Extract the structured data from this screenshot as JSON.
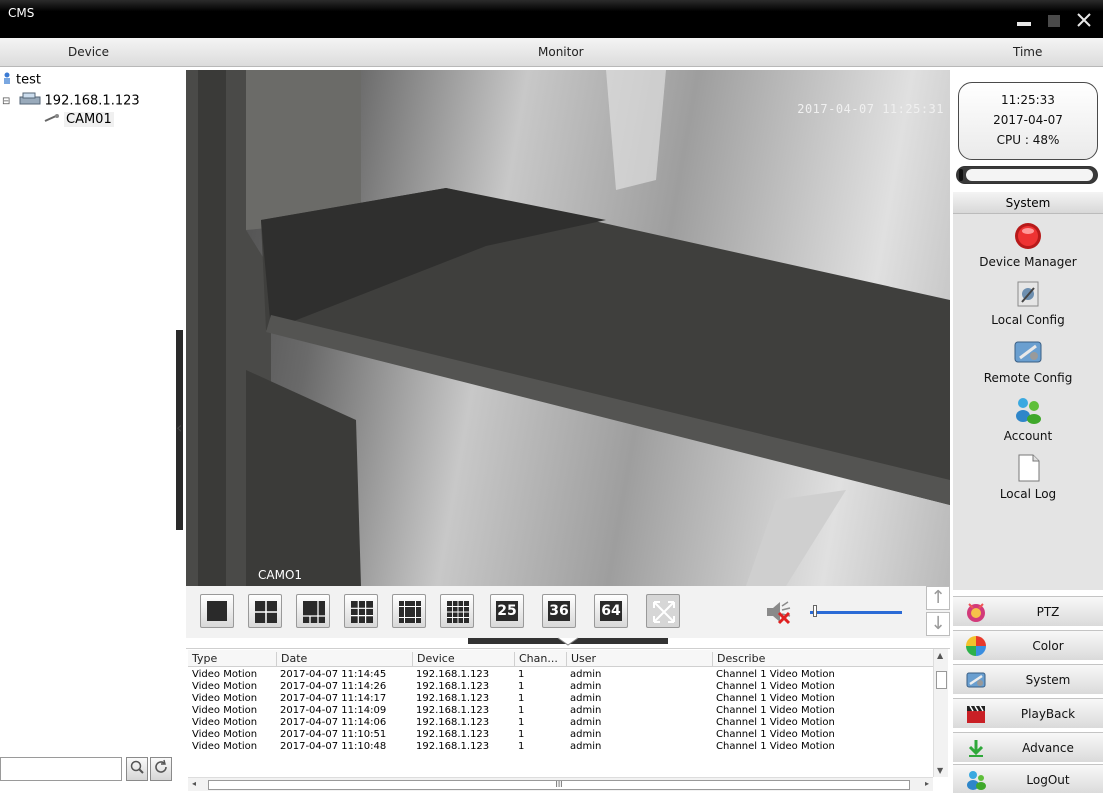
{
  "window": {
    "title": "CMS",
    "minimize_icon": "minimize-icon",
    "maximize_icon": "maximize-icon",
    "close_icon": "close-icon"
  },
  "header": {
    "device_label": "Device",
    "monitor_label": "Monitor",
    "time_label": "Time"
  },
  "device_tree": {
    "root": "test",
    "device": "192.168.1.123",
    "camera": "CAM01"
  },
  "video": {
    "osd_timestamp": "2017-04-07 11:25:31",
    "osd_camera": "CAMO1"
  },
  "toolbar": {
    "layout_25": "25",
    "layout_36": "36",
    "layout_64": "64",
    "volume_level": 0.03
  },
  "log": {
    "columns": [
      "Type",
      "Date",
      "Device",
      "Chan...",
      "User",
      "Describe"
    ],
    "rows": [
      [
        "Video Motion",
        "2017-04-07 11:14:45",
        "192.168.1.123",
        "1",
        "admin",
        "Channel 1 Video Motion"
      ],
      [
        "Video Motion",
        "2017-04-07 11:14:26",
        "192.168.1.123",
        "1",
        "admin",
        "Channel 1 Video Motion"
      ],
      [
        "Video Motion",
        "2017-04-07 11:14:17",
        "192.168.1.123",
        "1",
        "admin",
        "Channel 1 Video Motion"
      ],
      [
        "Video Motion",
        "2017-04-07 11:14:09",
        "192.168.1.123",
        "1",
        "admin",
        "Channel 1 Video Motion"
      ],
      [
        "Video Motion",
        "2017-04-07 11:14:06",
        "192.168.1.123",
        "1",
        "admin",
        "Channel 1 Video Motion"
      ],
      [
        "Video Motion",
        "2017-04-07 11:10:51",
        "192.168.1.123",
        "1",
        "admin",
        "Channel 1 Video Motion"
      ],
      [
        "Video Motion",
        "2017-04-07 11:10:48",
        "192.168.1.123",
        "1",
        "admin",
        "Channel 1 Video Motion"
      ]
    ],
    "hscroll_grip": "III"
  },
  "clock": {
    "time": "11:25:33",
    "date": "2017-04-07",
    "cpu": "CPU : 48%"
  },
  "system_panel": {
    "title": "System",
    "items": [
      {
        "label": "Device Manager",
        "icon": "device-manager-icon"
      },
      {
        "label": "Local Config",
        "icon": "local-config-icon"
      },
      {
        "label": "Remote Config",
        "icon": "remote-config-icon"
      },
      {
        "label": "Account",
        "icon": "account-icon"
      },
      {
        "label": "Local Log",
        "icon": "local-log-icon"
      }
    ]
  },
  "nav": {
    "ptz": "PTZ",
    "color": "Color",
    "system": "System",
    "playback": "PlayBack",
    "advance": "Advance",
    "logout": "LogOut"
  },
  "colors": {
    "accent": "#2b6bd6",
    "device_manager_red": "#d81e1e"
  }
}
